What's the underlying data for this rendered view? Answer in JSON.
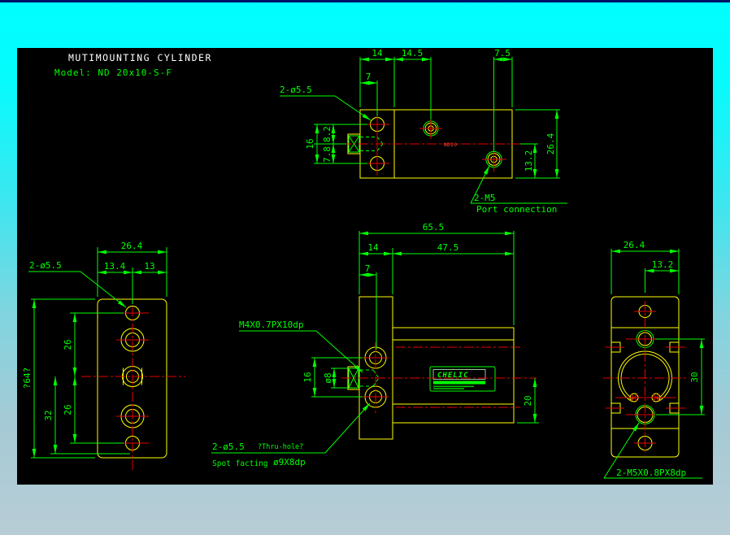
{
  "title": {
    "heading": "MUTIMOUNTING CYLINDER",
    "model": "Model: ND 20x10-S-F"
  },
  "top_view": {
    "dim_14": "14",
    "dim_14_5": "14.5",
    "dim_7_5": "7.5",
    "dim_7": "7",
    "dim_16": "16",
    "dim_8_2": "8.2",
    "dim_7_8": "7.8",
    "dim_26_4": "26.4",
    "dim_13_2": "13.2",
    "label_holes": "2-ø5.5",
    "label_port_line1": "2-M5",
    "label_port_line2": "Port connection",
    "body_mark": "ND20"
  },
  "left_view": {
    "dim_26_4": "26.4",
    "dim_13_4": "13.4",
    "dim_13": "13",
    "dim_64": "?64?",
    "dim_32": "32",
    "dim_26_upper": "26",
    "dim_26_lower": "26",
    "label_holes": "2-ø5.5"
  },
  "front_view": {
    "dim_65_5": "65.5",
    "dim_14": "14",
    "dim_47_5": "47.5",
    "dim_7": "7",
    "dim_16": "16",
    "dim_dia8": "ø8",
    "dim_20": "20",
    "label_thread": "M4X0.7PX10dp",
    "label_thru_hole_1": "2-ø5.5",
    "label_thru_hole_2": "?Thru-hole?",
    "label_spot_1": "Spot facting",
    "label_spot_2": "ø9X8dp",
    "brand": "CHELIC"
  },
  "right_view": {
    "dim_26_4": "26.4",
    "dim_13_2": "13.2",
    "dim_30": "30",
    "label_ports": "2-M5X0.8PX8dp"
  },
  "colors": {
    "outline": "#ffff00",
    "dimension": "#00ff00",
    "centerline": "#e60000",
    "title_text": "#ffffff",
    "canvas": "#000000"
  }
}
